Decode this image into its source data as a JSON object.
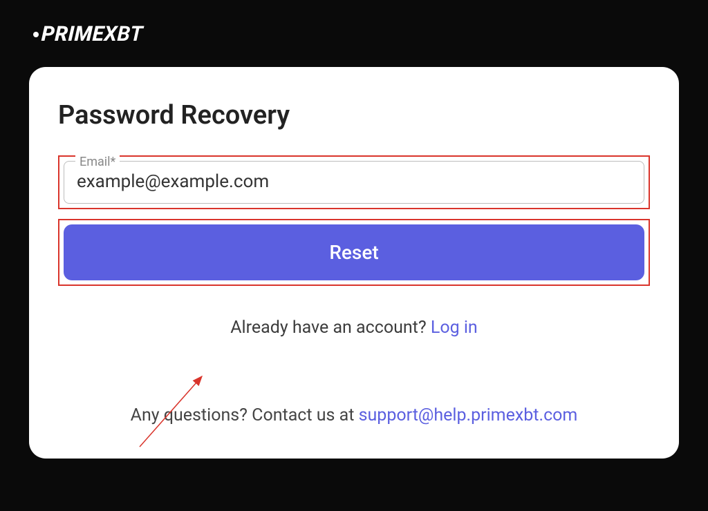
{
  "logo": {
    "prime": "PRIME",
    "xbt": "XBT"
  },
  "card": {
    "title": "Password Recovery",
    "email_label": "Email*",
    "email_value": "example@example.com",
    "reset_label": "Reset",
    "login_prompt": "Already have an account? ",
    "login_link": "Log in",
    "contact_prompt": "Any questions? Contact us at ",
    "contact_email": "support@help.primexbt.com"
  }
}
